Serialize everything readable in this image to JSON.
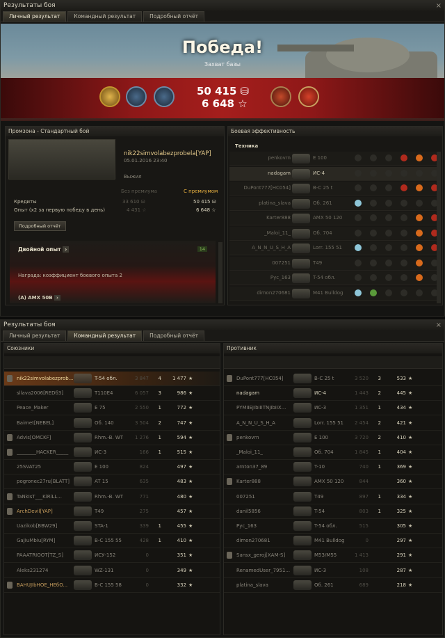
{
  "top_window": {
    "title": "Результаты боя",
    "close": "×",
    "tabs": [
      "Личный результат",
      "Командный результат",
      "Подробный отчёт"
    ],
    "active_tab": 0,
    "banner": {
      "result": "Победа!",
      "subtitle": "Захват базы",
      "credits": "50 415",
      "xp": "6 648"
    },
    "left": {
      "header": "Промзона - Стандартный бой",
      "player": "nik22simvolabezprobela[YAP]",
      "datetime": "05.01.2016 23:40",
      "status": "Выжил",
      "col_no_prem": "Без премиума",
      "col_prem": "С премиумом",
      "rows": [
        {
          "label": "Кредиты",
          "no_prem": "33 610",
          "prem": "50 415"
        },
        {
          "label": "Опыт  (x2 за первую победу в день)",
          "no_prem": "4 431",
          "prem": "6 648"
        }
      ],
      "detail_button": "Подробный отчёт",
      "double_xp": "Двойной опыт",
      "double_xp_count": "14",
      "reward": "Награда:  коэффициент боевого опыта 2",
      "next_tank": "(A) AMX 50B"
    },
    "right": {
      "header": "Боевая эффективность",
      "subheader": "Техника",
      "rows": [
        {
          "name": "penkovrn",
          "tank": "E 100",
          "icons": [
            "g",
            "g",
            "g",
            "r",
            "o",
            "r"
          ]
        },
        {
          "name": "nadagam",
          "tank": "ИС-4",
          "icons": [
            "g",
            "g",
            "g",
            "g",
            "g",
            "g"
          ],
          "me": true
        },
        {
          "name": "DuPont777[HC054]",
          "tank": "B-C 25 t",
          "icons": [
            "g",
            "g",
            "g",
            "r",
            "o",
            "r"
          ]
        },
        {
          "name": "platina_slava",
          "tank": "Об. 261",
          "icons": [
            "b",
            "g",
            "g",
            "g",
            "g",
            "g"
          ]
        },
        {
          "name": "Karter888",
          "tank": "AMX 50 120",
          "icons": [
            "g",
            "g",
            "g",
            "g",
            "o",
            "r"
          ]
        },
        {
          "name": "_Maloi_11_",
          "tank": "Об. 704",
          "icons": [
            "g",
            "g",
            "g",
            "g",
            "o",
            "r"
          ]
        },
        {
          "name": "A_N_N_U_S_H_A",
          "tank": "Lorr. 155 51",
          "icons": [
            "b",
            "g",
            "g",
            "g",
            "o",
            "r"
          ]
        },
        {
          "name": "007251",
          "tank": "T49",
          "icons": [
            "g",
            "g",
            "g",
            "g",
            "o",
            "g"
          ]
        },
        {
          "name": "Рус_163",
          "tank": "T-54 обл.",
          "icons": [
            "g",
            "g",
            "g",
            "g",
            "o",
            "g"
          ]
        },
        {
          "name": "dimon270681",
          "tank": "M41 Bulldog",
          "icons": [
            "b",
            "gr",
            "g",
            "g",
            "g",
            "g"
          ]
        }
      ]
    }
  },
  "bottom_window": {
    "title": "Результаты боя",
    "close": "×",
    "tabs": [
      "Личный результат",
      "Командный результат",
      "Подробный отчёт"
    ],
    "active_tab": 1,
    "allies_header": "Союзники",
    "enemies_header": "Противник",
    "star_symbol": "★",
    "allies": [
      {
        "name": "nik22simvolabezprob...",
        "tank": "T-54 обл.",
        "dmg": "3 847",
        "frags": "4",
        "xp": "1 477",
        "platoon": true,
        "me": true
      },
      {
        "name": "sllava2006[REDб3]",
        "tank": "T110E4",
        "dmg": "6 057",
        "frags": "3",
        "xp": "986"
      },
      {
        "name": "Peace_Maker",
        "tank": "E 75",
        "dmg": "2 550",
        "frags": "1",
        "xp": "772"
      },
      {
        "name": "Baimet[NEBEL]",
        "tank": "Об. 140",
        "dmg": "3 504",
        "frags": "2",
        "xp": "747"
      },
      {
        "name": "Advis[OMCKF]",
        "tank": "Rhm.-B. WT",
        "dmg": "1 276",
        "frags": "1",
        "xp": "594",
        "platoon": true
      },
      {
        "name": "________HACKER_____",
        "tank": "ИС-3",
        "dmg": "166",
        "frags": "1",
        "xp": "515",
        "platoon": true
      },
      {
        "name": "25SVAT25",
        "tank": "E 100",
        "dmg": "824",
        "frags": "",
        "xp": "497"
      },
      {
        "name": "pogronec27ru[BLATT]",
        "tank": "AT 15",
        "dmg": "635",
        "frags": "",
        "xp": "483"
      },
      {
        "name": "TaNkIsT___KiRiLL...",
        "tank": "Rhm.-B. WT",
        "dmg": "771",
        "frags": "",
        "xp": "480",
        "platoon": true
      },
      {
        "name": "ArchDevil[YAP]",
        "tank": "T49",
        "dmg": "275",
        "frags": "",
        "xp": "457",
        "platoon": true,
        "clan": true
      },
      {
        "name": "Uazikob[BBW29]",
        "tank": "STA-1",
        "dmg": "339",
        "frags": "1",
        "xp": "455"
      },
      {
        "name": "GaJIuMbIu[RYM]",
        "tank": "B-C 155 55",
        "dmg": "428",
        "frags": "1",
        "xp": "410"
      },
      {
        "name": "PAAATRIOOT[TZ_S]",
        "tank": "ИСУ-152",
        "dmg": "0",
        "frags": "",
        "xp": "351"
      },
      {
        "name": "Aleks231274",
        "tank": "WZ-131",
        "dmg": "0",
        "frags": "",
        "xp": "349"
      },
      {
        "name": "BAHUJIbHOE_HEбO...",
        "tank": "B-C 155 58",
        "dmg": "0",
        "frags": "",
        "xp": "332",
        "platoon": true,
        "clan": true
      }
    ],
    "enemies": [
      {
        "name": "DuPont777[HC054]",
        "tank": "B-C 25 t",
        "dmg": "3 520",
        "frags": "3",
        "xp": "533",
        "platoon": true
      },
      {
        "name": "nadagam",
        "tank": "ИС-4",
        "dmg": "1 443",
        "frags": "2",
        "xp": "445",
        "alive": true
      },
      {
        "name": "PYMIIEJIbIIITNJIbIIX...",
        "tank": "ИС-3",
        "dmg": "1 351",
        "frags": "1",
        "xp": "434"
      },
      {
        "name": "A_N_N_U_S_H_A",
        "tank": "Lorr. 155 51",
        "dmg": "2 454",
        "frags": "2",
        "xp": "421"
      },
      {
        "name": "penkovrn",
        "tank": "E 100",
        "dmg": "3 720",
        "frags": "2",
        "xp": "410",
        "platoon": true
      },
      {
        "name": "_Maloi_11_",
        "tank": "Об. 704",
        "dmg": "1 845",
        "frags": "1",
        "xp": "404"
      },
      {
        "name": "arnton37_89",
        "tank": "T-10",
        "dmg": "740",
        "frags": "1",
        "xp": "369"
      },
      {
        "name": "Karter888",
        "tank": "AMX 50 120",
        "dmg": "844",
        "frags": "",
        "xp": "360",
        "platoon": true
      },
      {
        "name": "007251",
        "tank": "T49",
        "dmg": "897",
        "frags": "1",
        "xp": "334"
      },
      {
        "name": "danil5856",
        "tank": "T-54",
        "dmg": "803",
        "frags": "1",
        "xp": "325"
      },
      {
        "name": "Рус_163",
        "tank": "T-54 обл.",
        "dmg": "515",
        "frags": "",
        "xp": "305"
      },
      {
        "name": "dimon270681",
        "tank": "M41 Bulldog",
        "dmg": "0",
        "frags": "",
        "xp": "297"
      },
      {
        "name": "Sansx_geroj[XAM-S]",
        "tank": "M53/M55",
        "dmg": "1 413",
        "frags": "",
        "xp": "291",
        "platoon": true
      },
      {
        "name": "RenamedUser_7951...",
        "tank": "ИС-3",
        "dmg": "108",
        "frags": "",
        "xp": "287"
      },
      {
        "name": "platina_slava",
        "tank": "Об. 261",
        "dmg": "689",
        "frags": "",
        "xp": "218"
      }
    ]
  }
}
